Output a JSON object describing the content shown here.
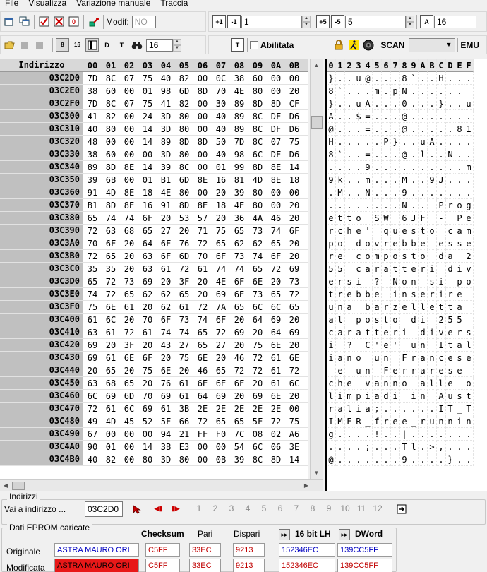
{
  "menu": [
    "File",
    "Visualizza",
    "Variazione manuale",
    "Traccia"
  ],
  "toolbar": {
    "modif_label": "Modif:",
    "modif_value": "NO",
    "step_small": "1",
    "step_large": "5",
    "font_size": "16",
    "search_len": "16",
    "abilitata": "Abilitata",
    "scan_label": "SCAN",
    "emu_label": "EMU"
  },
  "hex": {
    "address_header": "Indirizzo",
    "columns": [
      "00",
      "01",
      "02",
      "03",
      "04",
      "05",
      "06",
      "07",
      "08",
      "09",
      "0A",
      "0B"
    ],
    "rows": [
      {
        "addr": "03C2D0",
        "bytes": [
          "7D",
          "8C",
          "07",
          "75",
          "40",
          "82",
          "00",
          "0C",
          "38",
          "60",
          "00",
          "00"
        ]
      },
      {
        "addr": "03C2E0",
        "bytes": [
          "38",
          "60",
          "00",
          "01",
          "98",
          "6D",
          "8D",
          "70",
          "4E",
          "80",
          "00",
          "20"
        ]
      },
      {
        "addr": "03C2F0",
        "bytes": [
          "7D",
          "8C",
          "07",
          "75",
          "41",
          "82",
          "00",
          "30",
          "89",
          "8D",
          "8D",
          "CF"
        ]
      },
      {
        "addr": "03C300",
        "bytes": [
          "41",
          "82",
          "00",
          "24",
          "3D",
          "80",
          "00",
          "40",
          "89",
          "8C",
          "DF",
          "D6"
        ]
      },
      {
        "addr": "03C310",
        "bytes": [
          "40",
          "80",
          "00",
          "14",
          "3D",
          "80",
          "00",
          "40",
          "89",
          "8C",
          "DF",
          "D6"
        ]
      },
      {
        "addr": "03C320",
        "bytes": [
          "48",
          "00",
          "00",
          "14",
          "89",
          "8D",
          "8D",
          "50",
          "7D",
          "8C",
          "07",
          "75"
        ]
      },
      {
        "addr": "03C330",
        "bytes": [
          "38",
          "60",
          "00",
          "00",
          "3D",
          "80",
          "00",
          "40",
          "98",
          "6C",
          "DF",
          "D6"
        ]
      },
      {
        "addr": "03C340",
        "bytes": [
          "89",
          "8D",
          "8E",
          "14",
          "39",
          "8C",
          "00",
          "01",
          "99",
          "8D",
          "8E",
          "14"
        ]
      },
      {
        "addr": "03C350",
        "bytes": [
          "39",
          "6B",
          "00",
          "01",
          "B1",
          "6D",
          "8E",
          "16",
          "81",
          "4D",
          "8E",
          "18"
        ]
      },
      {
        "addr": "03C360",
        "bytes": [
          "91",
          "4D",
          "8E",
          "18",
          "4E",
          "80",
          "00",
          "20",
          "39",
          "80",
          "00",
          "00"
        ]
      },
      {
        "addr": "03C370",
        "bytes": [
          "B1",
          "8D",
          "8E",
          "16",
          "91",
          "8D",
          "8E",
          "18",
          "4E",
          "80",
          "00",
          "20"
        ]
      },
      {
        "addr": "03C380",
        "bytes": [
          "65",
          "74",
          "74",
          "6F",
          "20",
          "53",
          "57",
          "20",
          "36",
          "4A",
          "46",
          "20"
        ]
      },
      {
        "addr": "03C390",
        "bytes": [
          "72",
          "63",
          "68",
          "65",
          "27",
          "20",
          "71",
          "75",
          "65",
          "73",
          "74",
          "6F"
        ]
      },
      {
        "addr": "03C3A0",
        "bytes": [
          "70",
          "6F",
          "20",
          "64",
          "6F",
          "76",
          "72",
          "65",
          "62",
          "62",
          "65",
          "20"
        ]
      },
      {
        "addr": "03C3B0",
        "bytes": [
          "72",
          "65",
          "20",
          "63",
          "6F",
          "6D",
          "70",
          "6F",
          "73",
          "74",
          "6F",
          "20"
        ]
      },
      {
        "addr": "03C3C0",
        "bytes": [
          "35",
          "35",
          "20",
          "63",
          "61",
          "72",
          "61",
          "74",
          "74",
          "65",
          "72",
          "69"
        ]
      },
      {
        "addr": "03C3D0",
        "bytes": [
          "65",
          "72",
          "73",
          "69",
          "20",
          "3F",
          "20",
          "4E",
          "6F",
          "6E",
          "20",
          "73"
        ]
      },
      {
        "addr": "03C3E0",
        "bytes": [
          "74",
          "72",
          "65",
          "62",
          "62",
          "65",
          "20",
          "69",
          "6E",
          "73",
          "65",
          "72"
        ]
      },
      {
        "addr": "03C3F0",
        "bytes": [
          "75",
          "6E",
          "61",
          "20",
          "62",
          "61",
          "72",
          "7A",
          "65",
          "6C",
          "6C",
          "65"
        ]
      },
      {
        "addr": "03C400",
        "bytes": [
          "61",
          "6C",
          "20",
          "70",
          "6F",
          "73",
          "74",
          "6F",
          "20",
          "64",
          "69",
          "20"
        ]
      },
      {
        "addr": "03C410",
        "bytes": [
          "63",
          "61",
          "72",
          "61",
          "74",
          "74",
          "65",
          "72",
          "69",
          "20",
          "64",
          "69"
        ]
      },
      {
        "addr": "03C420",
        "bytes": [
          "69",
          "20",
          "3F",
          "20",
          "43",
          "27",
          "65",
          "27",
          "20",
          "75",
          "6E",
          "20"
        ]
      },
      {
        "addr": "03C430",
        "bytes": [
          "69",
          "61",
          "6E",
          "6F",
          "20",
          "75",
          "6E",
          "20",
          "46",
          "72",
          "61",
          "6E"
        ]
      },
      {
        "addr": "03C440",
        "bytes": [
          "20",
          "65",
          "20",
          "75",
          "6E",
          "20",
          "46",
          "65",
          "72",
          "72",
          "61",
          "72"
        ]
      },
      {
        "addr": "03C450",
        "bytes": [
          "63",
          "68",
          "65",
          "20",
          "76",
          "61",
          "6E",
          "6E",
          "6F",
          "20",
          "61",
          "6C"
        ]
      },
      {
        "addr": "03C460",
        "bytes": [
          "6C",
          "69",
          "6D",
          "70",
          "69",
          "61",
          "64",
          "69",
          "20",
          "69",
          "6E",
          "20"
        ]
      },
      {
        "addr": "03C470",
        "bytes": [
          "72",
          "61",
          "6C",
          "69",
          "61",
          "3B",
          "2E",
          "2E",
          "2E",
          "2E",
          "2E",
          "00"
        ]
      },
      {
        "addr": "03C480",
        "bytes": [
          "49",
          "4D",
          "45",
          "52",
          "5F",
          "66",
          "72",
          "65",
          "65",
          "5F",
          "72",
          "75"
        ]
      },
      {
        "addr": "03C490",
        "bytes": [
          "67",
          "00",
          "00",
          "00",
          "94",
          "21",
          "FF",
          "F0",
          "7C",
          "08",
          "02",
          "A6"
        ]
      },
      {
        "addr": "03C4A0",
        "bytes": [
          "90",
          "01",
          "00",
          "14",
          "3B",
          "E3",
          "00",
          "00",
          "54",
          "6C",
          "06",
          "3E"
        ]
      },
      {
        "addr": "03C4B0",
        "bytes": [
          "40",
          "82",
          "00",
          "80",
          "3D",
          "80",
          "00",
          "0B",
          "39",
          "8C",
          "8D",
          "14"
        ]
      }
    ]
  },
  "ascii": {
    "columns": [
      "0",
      "1",
      "2",
      "3",
      "4",
      "5",
      "6",
      "7",
      "8",
      "9",
      "A",
      "B",
      "C",
      "D",
      "E",
      "F"
    ],
    "rows": [
      "}..u@...8`..H...",
      "8`...m.pN...... ",
      "}..uA...0...}..u",
      "A..$=...@.......",
      "@...=...@.....81",
      "H.....P}..uA....",
      "8`..=...@.l..N..",
      "....9..........m",
      "9k..m...M..9J...",
      ".M..N...9.......",
      "........N.. Prog",
      "etto SW 6JF - Pe",
      "rche' questo cam",
      "po dovrebbe esse",
      "re composto da 2",
      "55 caratteri div",
      "ersi ? Non si po",
      "trebbe inserire ",
      "una barzelletta ",
      "al posto di 255 ",
      "caratteri divers",
      "i ? C'e' un Ital",
      "iano un Francese",
      " e un Ferrarese ",
      "che vanno alle o",
      "limpiadi in Aust",
      "ralia;......IT_T",
      "IMER_free_runnin",
      "g....!..|.......",
      "....;...Tl.>,...",
      "@.......9....}.."
    ]
  },
  "bottom": {
    "indirizzi_title": "Indirizzi",
    "goto_label": "Vai a indirizzo ...",
    "goto_value": "03C2D0",
    "page_numbers": [
      "1",
      "2",
      "3",
      "4",
      "5",
      "6",
      "7",
      "8",
      "9",
      "10",
      "11",
      "12"
    ],
    "eprom_title": "Dati EPROM caricate",
    "headers": [
      "Checksum",
      "Pari",
      "Dispari",
      "16 bit LH",
      "DWord"
    ],
    "rows": [
      {
        "label": "Originale",
        "name": "ASTRA MAURO ORI",
        "checksum": "C5FF",
        "pari": "33EC",
        "dispari": "9213",
        "bit16": "152346EC",
        "dword": "139CC5FF"
      },
      {
        "label": "Modificata",
        "name": "ASTRA MAURO ORI",
        "checksum": "C5FF",
        "pari": "33EC",
        "dispari": "9213",
        "bit16": "152346EC",
        "dword": "139CC5FF"
      }
    ]
  },
  "colors": {
    "address_bg": "#c0c0c0",
    "modified_highlight": "#e81818",
    "value_red": "#c00000",
    "value_blue": "#0000c0"
  }
}
